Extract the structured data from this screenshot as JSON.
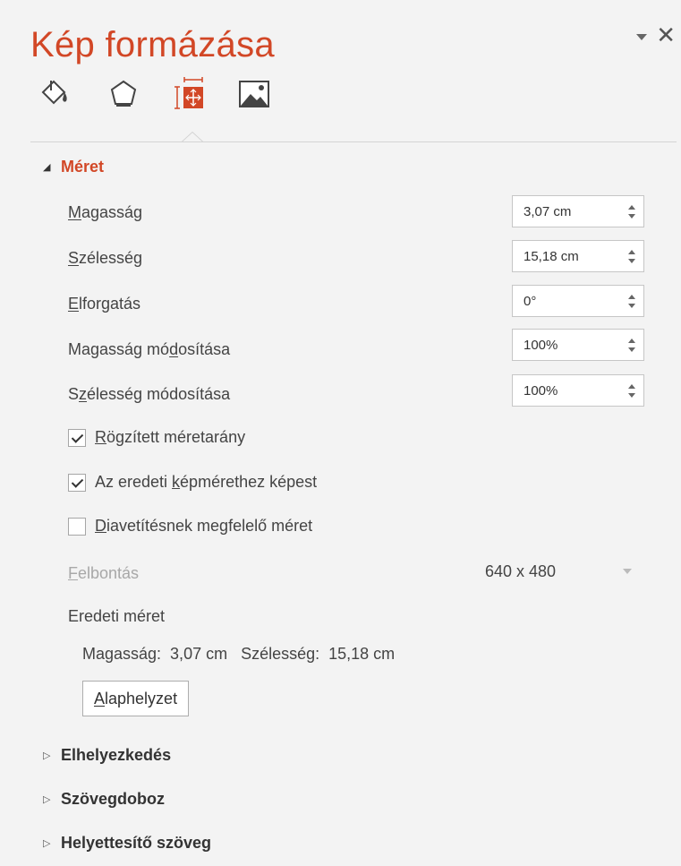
{
  "pane": {
    "title": "Kép formázása",
    "menu_icon": "dropdown-triangle-icon",
    "close_glyph": "✕"
  },
  "tabs": [
    {
      "name": "fill-line",
      "icon": "paint-bucket-icon"
    },
    {
      "name": "effects",
      "icon": "pentagon-icon"
    },
    {
      "name": "size-properties",
      "icon": "size-position-icon",
      "active": true
    },
    {
      "name": "picture",
      "icon": "picture-icon"
    }
  ],
  "size_section": {
    "title": "Méret",
    "fields": [
      {
        "accel": "M",
        "rest": "agasság",
        "value": "3,07 cm"
      },
      {
        "accel": "S",
        "rest": "zélesség",
        "value": "15,18 cm"
      },
      {
        "accel": "E",
        "rest": "lforgatás",
        "value": "0°"
      },
      {
        "pre": "Magasság mó",
        "accel": "d",
        "rest": "osítása",
        "value": "100%"
      },
      {
        "pre": "S",
        "accel": "z",
        "rest": "élesség módosítása",
        "value": "100%"
      }
    ],
    "checks": [
      {
        "pre": "",
        "accel": "R",
        "rest": "ögzített méretarány",
        "checked": true
      },
      {
        "pre": "Az eredeti ",
        "accel": "k",
        "rest": "épmérethez képest",
        "checked": true
      },
      {
        "pre": "",
        "accel": "D",
        "rest": "iavetítésnek megfelelő méret",
        "checked": false
      }
    ],
    "resolution_label_accel": "F",
    "resolution_label_rest": "elbontás",
    "resolution_value": "640 x 480",
    "original_size_label": "Eredeti méret",
    "original_size_text": "Magasság:  3,07 cm   Szélesség:  15,18 cm",
    "reset_accel": "A",
    "reset_rest": "laphelyzet"
  },
  "collapsed_sections": [
    {
      "title": "Elhelyezkedés"
    },
    {
      "title": "Szövegdoboz"
    },
    {
      "title": "Helyettesítő szöveg"
    }
  ],
  "colors": {
    "accent": "#d24726",
    "background": "#f3f3f3"
  }
}
